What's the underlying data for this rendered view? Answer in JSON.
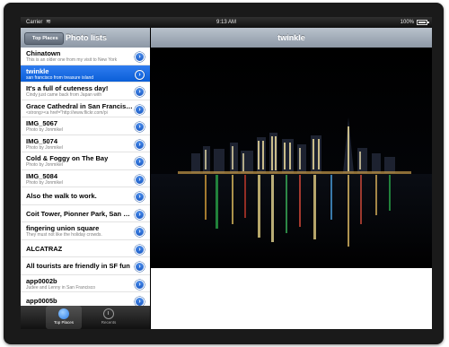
{
  "status_bar": {
    "carrier": "Carrier",
    "time": "9:13 AM",
    "battery": "100%"
  },
  "master": {
    "back_button": "Top Places",
    "title": "Photo lists"
  },
  "photos": [
    {
      "title": "Chinatown",
      "subtitle": "This is an older one from my visit to New York",
      "selected": false
    },
    {
      "title": "twinkle",
      "subtitle": "san francisco from treasure island",
      "selected": true
    },
    {
      "title": "It's a full of cuteness day!",
      "subtitle": "Cindy just came back from Japan with",
      "selected": false
    },
    {
      "title": "Grace Cathedral in San Francisco",
      "subtitle": "<strong><a href=\"http://www.flickr.com/pi",
      "selected": false
    },
    {
      "title": "IMG_5067",
      "subtitle": "Photo by Jonmikel",
      "selected": false
    },
    {
      "title": "IMG_5074",
      "subtitle": "Photo by Jonmikel",
      "selected": false
    },
    {
      "title": "Cold & Foggy on The Bay",
      "subtitle": "Photo by Jonmikel",
      "selected": false
    },
    {
      "title": "IMG_5084",
      "subtitle": "Photo by Jonmikel",
      "selected": false
    },
    {
      "title": "Also the walk to work.",
      "subtitle": "",
      "selected": false
    },
    {
      "title": "Coit Tower, Pionner Park, San Francisco",
      "subtitle": "",
      "selected": false
    },
    {
      "title": "fingering union square",
      "subtitle": "They must not like the holiday crowds.",
      "selected": false
    },
    {
      "title": "ALCATRAZ",
      "subtitle": "",
      "selected": false
    },
    {
      "title": "All tourists are friendly in SF fun",
      "subtitle": "",
      "selected": false
    },
    {
      "title": "app0002b",
      "subtitle": "Judee and Lenny in San Francisco",
      "selected": false
    },
    {
      "title": "app0005b",
      "subtitle": "",
      "selected": false
    }
  ],
  "tabs": [
    {
      "label": "Top Places",
      "icon": "top-places-icon",
      "active": true
    },
    {
      "label": "Recents",
      "icon": "clock-icon",
      "active": false
    }
  ],
  "detail": {
    "title": "twinkle"
  },
  "colors": {
    "nav_bar": "#9aa4b1",
    "selection": "#1565e0",
    "disclosure": "#2f72dc"
  }
}
